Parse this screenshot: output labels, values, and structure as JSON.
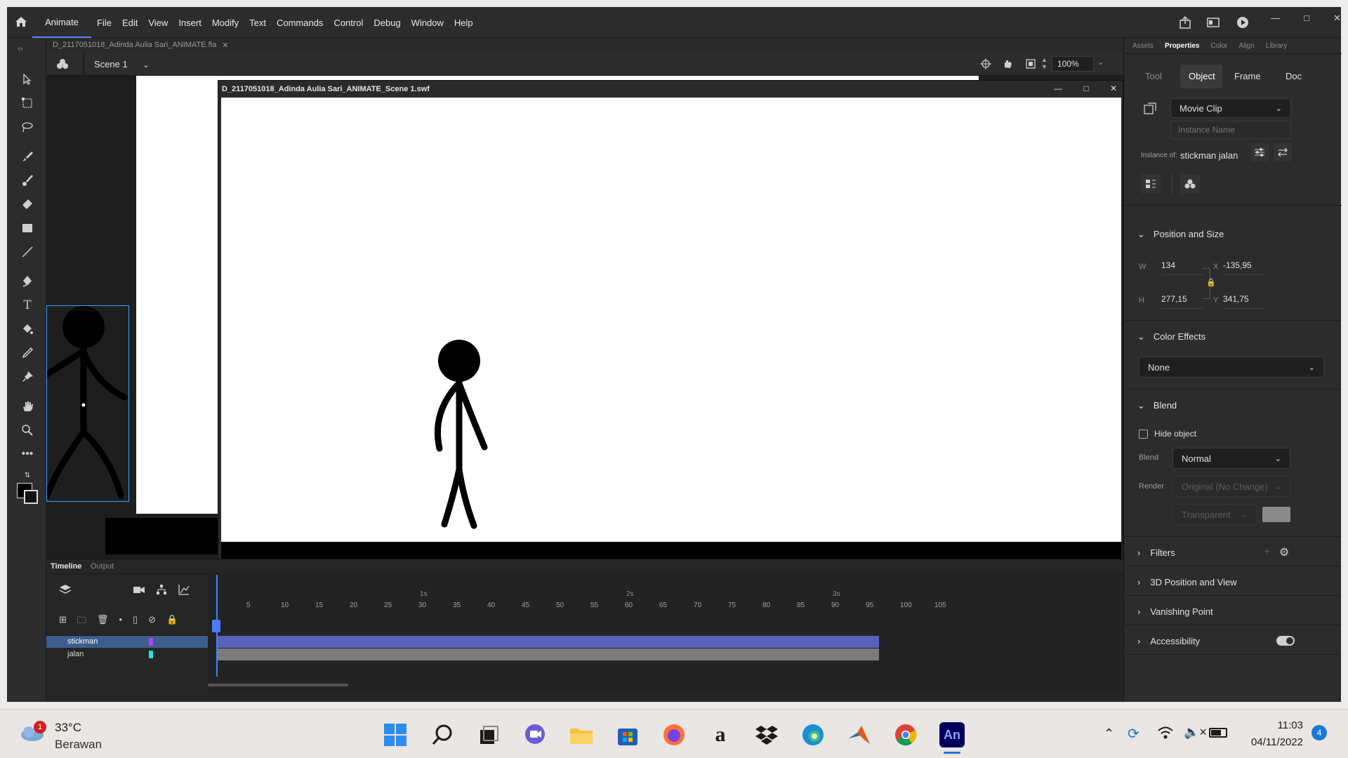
{
  "app": {
    "name": "Animate",
    "menu": [
      "File",
      "Edit",
      "View",
      "Insert",
      "Modify",
      "Text",
      "Commands",
      "Control",
      "Debug",
      "Window",
      "Help"
    ]
  },
  "document": {
    "tab_name": "D_2117051018_Adinda Aulia Sari_ANIMATE.fla",
    "scene": "Scene 1",
    "zoom": "100%"
  },
  "swf_window": {
    "title": "D_2117051018_Adinda Aulia Sari_ANIMATE_Scene 1.swf"
  },
  "timeline": {
    "tabs": [
      "Timeline",
      "Output"
    ],
    "layers": [
      {
        "name": "stickman",
        "color": "#b040ff",
        "selected": true
      },
      {
        "name": "jalan",
        "color": "#22e0e0",
        "selected": false
      }
    ],
    "frame_labels": [
      "5",
      "10",
      "15",
      "20",
      "25",
      "30",
      "35",
      "40",
      "45",
      "50",
      "55",
      "60",
      "65",
      "70",
      "75",
      "80",
      "85",
      "90",
      "95",
      "100",
      "105"
    ],
    "second_labels": [
      "1s",
      "2s",
      "3s"
    ]
  },
  "properties": {
    "top_tabs": [
      "Assets",
      "Properties",
      "Color",
      "Align",
      "Library"
    ],
    "sub_tabs": [
      "Tool",
      "Object",
      "Frame",
      "Doc"
    ],
    "symbol_type": "Movie Clip",
    "instance_name_placeholder": "Instance Name",
    "instance_of_label": "Instance of:",
    "instance_of_value": "stickman jalan",
    "position_size": {
      "title": "Position and Size",
      "w_label": "W",
      "w": "134",
      "h_label": "H",
      "h": "277,15",
      "x_label": "X",
      "x": "-135,95",
      "y_label": "Y",
      "y": "341,75"
    },
    "color_effects": {
      "title": "Color Effects",
      "value": "None"
    },
    "blend": {
      "title": "Blend",
      "hide_object": "Hide object",
      "blend_label": "Blend",
      "blend_value": "Normal",
      "render_label": "Render",
      "render_value": "Original (No Change)",
      "transparent_value": "Transparent"
    },
    "collapsed_sections": [
      "Filters",
      "3D Position and View",
      "Vanishing Point",
      "Accessibility"
    ]
  },
  "taskbar": {
    "weather_temp": "33°C",
    "weather_desc": "Berawan",
    "weather_badge": "1",
    "time": "11:03",
    "date": "04/11/2022",
    "notification_count": "4"
  }
}
